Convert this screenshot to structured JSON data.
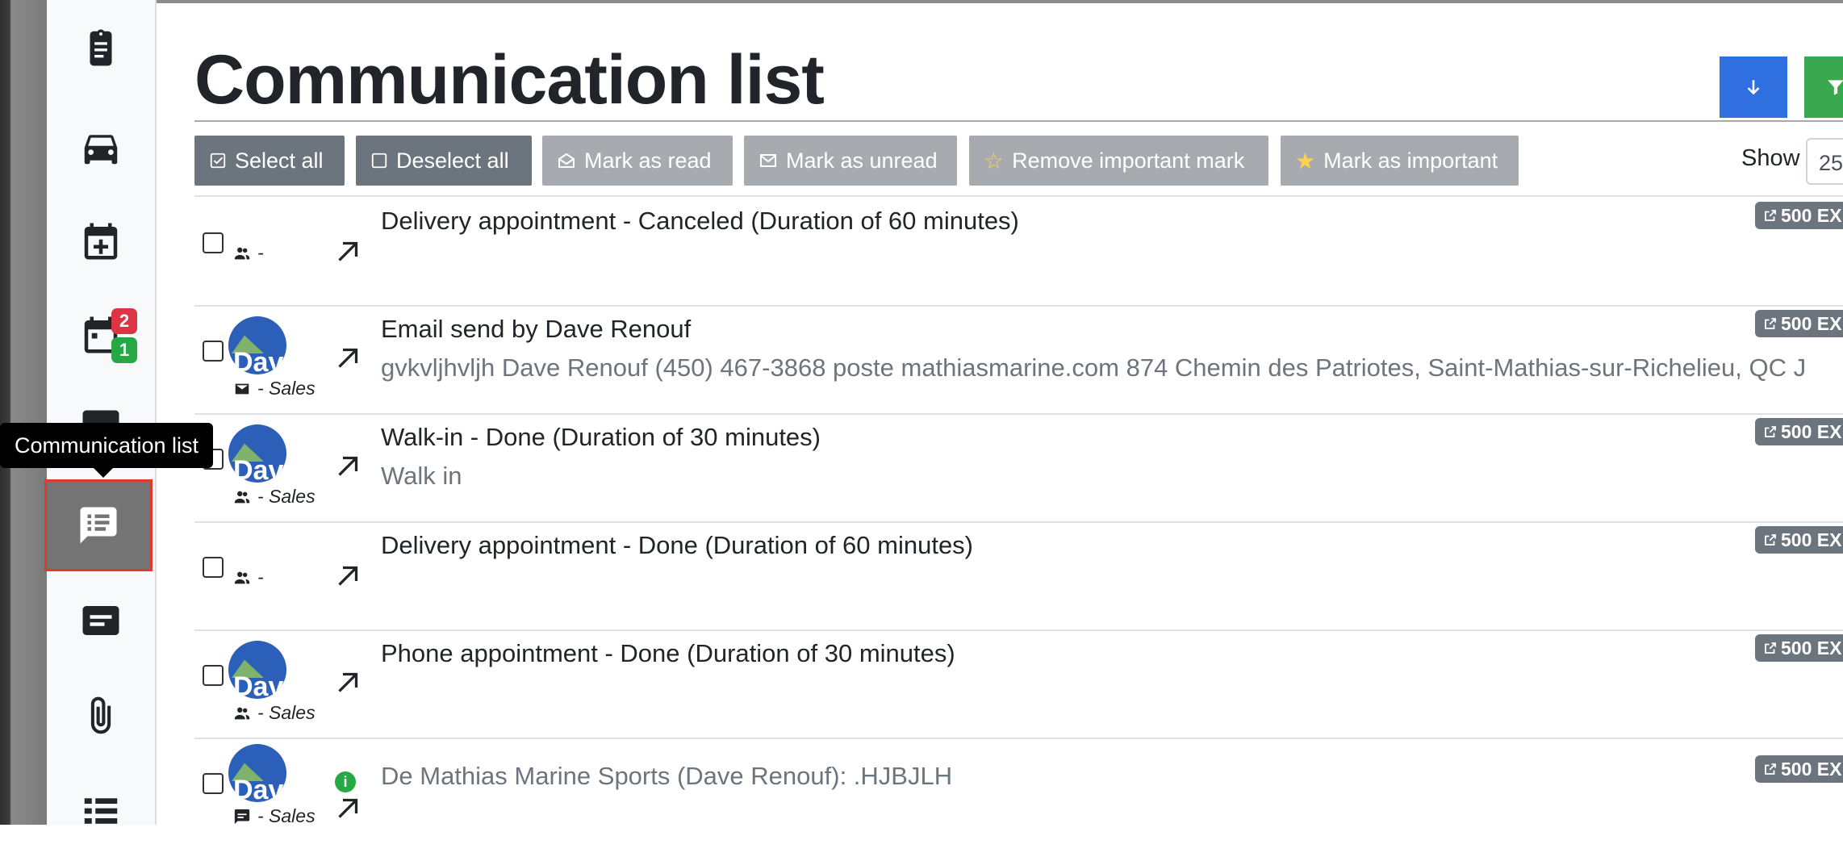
{
  "page": {
    "title": "Communication list"
  },
  "sidebar": {
    "tooltip": "Communication list",
    "badges": {
      "red": "2",
      "green": "1"
    },
    "icons": [
      "clipboard-icon",
      "car-icon",
      "calendar-plus-icon",
      "calendar-icon",
      "chat-icon",
      "message-list-icon",
      "card-icon",
      "paperclip-icon",
      "list-icon"
    ]
  },
  "toolbar": {
    "select_all": "Select all",
    "deselect_all": "Deselect all",
    "mark_read": "Mark as read",
    "mark_unread": "Mark as unread",
    "remove_important": "Remove important mark",
    "mark_important": "Mark as important",
    "show_label": "Show",
    "show_value": "25"
  },
  "rows": [
    {
      "title": "Delivery appointment - Canceled (Duration of 60 minutes)",
      "subtitle": "",
      "who": "-",
      "badge": "500 EX",
      "avatar": false,
      "type_icon": "people-icon"
    },
    {
      "title": "Email send by Dave Renouf",
      "subtitle": "gvkvljhvljh Dave Renouf (450) 467-3868 poste mathiasmarine.com 874 Chemin des Patriotes, Saint-Mathias-sur-Richelieu, QC J",
      "who": "- Sales",
      "badge": "500 EX",
      "avatar": true,
      "type_icon": "envelope-icon"
    },
    {
      "title": "Walk-in - Done (Duration of 30 minutes)",
      "subtitle": "Walk in",
      "who": "- Sales",
      "badge": "500 EX",
      "avatar": true,
      "type_icon": "people-icon"
    },
    {
      "title": "Delivery appointment - Done (Duration of 60 minutes)",
      "subtitle": "",
      "who": "-",
      "badge": "500 EX",
      "avatar": false,
      "type_icon": "people-icon"
    },
    {
      "title": "Phone appointment - Done (Duration of 30 minutes)",
      "subtitle": "",
      "who": "- Sales",
      "badge": "500 EX",
      "avatar": true,
      "type_icon": "people-icon"
    },
    {
      "title": "",
      "subtitle": "De Mathias Marine Sports (Dave Renouf): .HJBJLH",
      "who": "- Sales",
      "badge": "500 EX",
      "avatar": true,
      "type_icon": "chat-icon"
    }
  ],
  "avatar_text": "Dav",
  "info_mark": "i",
  "colors": {
    "primary": "#2f6fe0",
    "success": "#3aa84e",
    "secondary": "#6c757d",
    "danger": "#dc3545",
    "highlight": "#e5382c"
  }
}
